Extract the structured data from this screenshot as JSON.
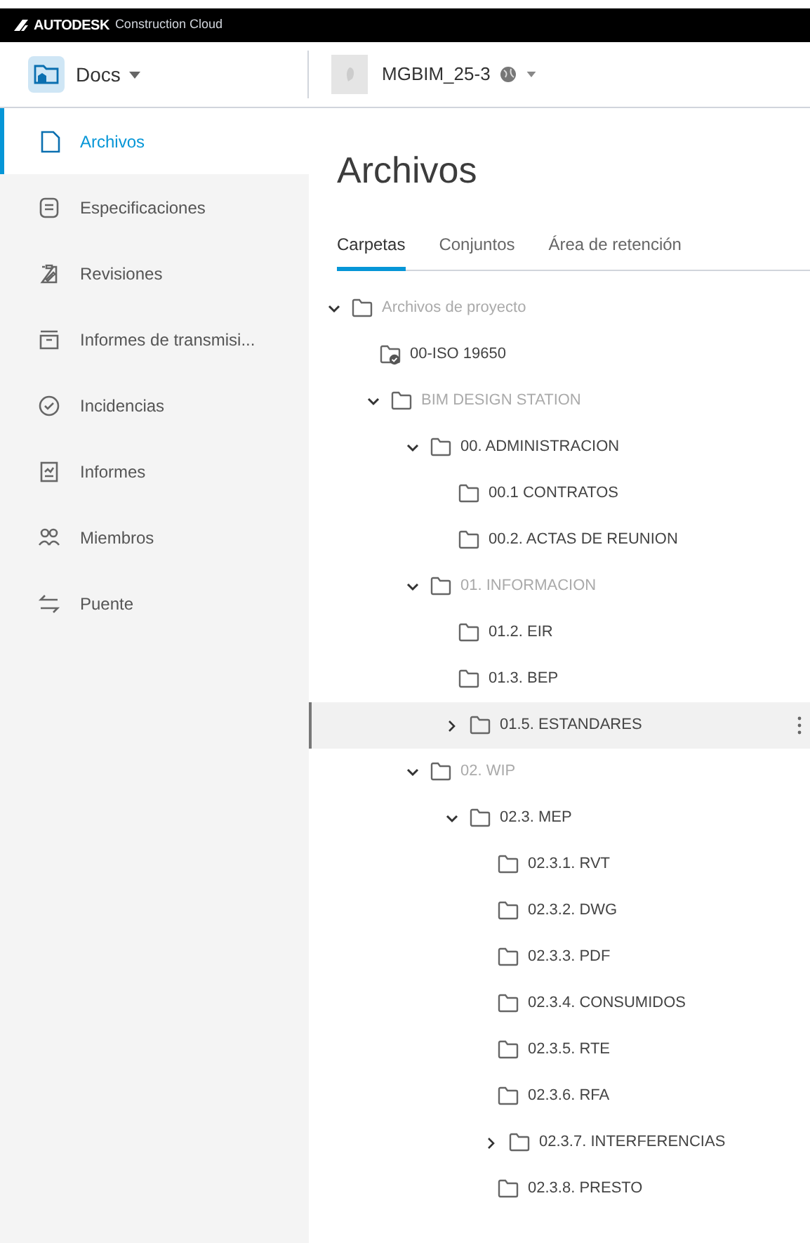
{
  "brand": {
    "name": "AUTODESK",
    "product": "Construction Cloud"
  },
  "header": {
    "module": "Docs",
    "project": "MGBIM_25-3"
  },
  "sidebar": {
    "items": [
      {
        "label": "Archivos",
        "selected": true
      },
      {
        "label": "Especificaciones",
        "selected": false
      },
      {
        "label": "Revisiones",
        "selected": false
      },
      {
        "label": "Informes de transmisi...",
        "selected": false
      },
      {
        "label": "Incidencias",
        "selected": false
      },
      {
        "label": "Informes",
        "selected": false
      },
      {
        "label": "Miembros",
        "selected": false
      },
      {
        "label": "Puente",
        "selected": false
      }
    ]
  },
  "page_title": "Archivos",
  "tabs": [
    {
      "label": "Carpetas",
      "selected": true
    },
    {
      "label": "Conjuntos",
      "selected": false
    },
    {
      "label": "Área de retención",
      "selected": false
    }
  ],
  "tree": [
    {
      "label": "Archivos de proyecto",
      "dimmed": true,
      "expanded": true,
      "children": [
        {
          "label": "00-ISO 19650",
          "kind": "shared"
        },
        {
          "label": "BIM DESIGN STATION",
          "dimmed": true,
          "expanded": true,
          "children": [
            {
              "label": "00. ADMINISTRACION",
              "expanded": true,
              "children": [
                {
                  "label": "00.1 CONTRATOS"
                },
                {
                  "label": "00.2. ACTAS DE REUNION"
                }
              ]
            },
            {
              "label": "01. INFORMACION",
              "dimmed": true,
              "expanded": true,
              "children": [
                {
                  "label": "01.2. EIR"
                },
                {
                  "label": "01.3. BEP"
                },
                {
                  "label": "01.5. ESTANDARES",
                  "expanded": false,
                  "hovered": true
                }
              ]
            },
            {
              "label": "02. WIP",
              "dimmed": true,
              "expanded": true,
              "children": [
                {
                  "label": "02.3. MEP",
                  "expanded": true,
                  "children": [
                    {
                      "label": "02.3.1. RVT"
                    },
                    {
                      "label": "02.3.2. DWG"
                    },
                    {
                      "label": "02.3.3. PDF"
                    },
                    {
                      "label": "02.3.4. CONSUMIDOS"
                    },
                    {
                      "label": "02.3.5. RTE"
                    },
                    {
                      "label": "02.3.6. RFA"
                    },
                    {
                      "label": "02.3.7. INTERFERENCIAS",
                      "expanded": false
                    },
                    {
                      "label": "02.3.8. PRESTO"
                    }
                  ]
                }
              ]
            }
          ]
        }
      ]
    }
  ]
}
